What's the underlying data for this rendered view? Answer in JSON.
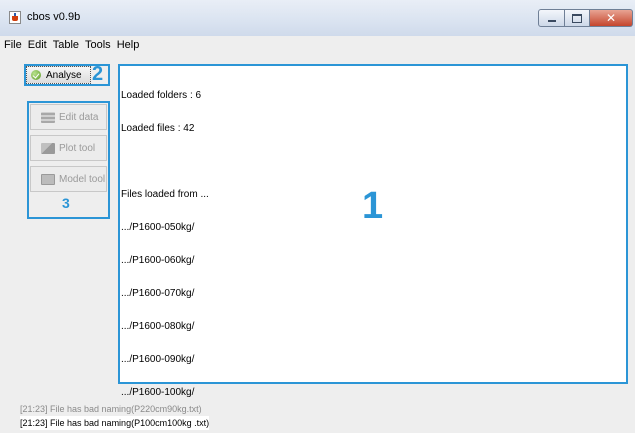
{
  "window": {
    "title": "cbos v0.9b",
    "controls": {
      "minimize": "–",
      "maximize": "□",
      "close": "✕"
    }
  },
  "menu": [
    "File",
    "Edit",
    "Table",
    "Tools",
    "Help"
  ],
  "left_panel": {
    "analyse_label": "Analyse",
    "analyse_marker": "2",
    "tools": [
      {
        "label": "Edit data",
        "icon": "table-icon"
      },
      {
        "label": "Plot tool",
        "icon": "plot-icon"
      },
      {
        "label": "Model tool",
        "icon": "model-icon"
      }
    ],
    "tools_marker": "3"
  },
  "output": {
    "lines": [
      "Loaded folders : 6",
      "Loaded files : 42",
      "",
      "Files loaded from ...",
      ".../P1600-050kg/",
      ".../P1600-060kg/",
      ".../P1600-070kg/",
      ".../P1600-080kg/",
      ".../P1600-090kg/",
      ".../P1600-100kg/"
    ],
    "marker": "1"
  },
  "log": [
    "[21:23] File has bad naming(P220cm90kg.txt)",
    "[21:23] File has bad naming(P100cm100kg .txt)"
  ],
  "colors": {
    "accent": "#2b95d6"
  }
}
